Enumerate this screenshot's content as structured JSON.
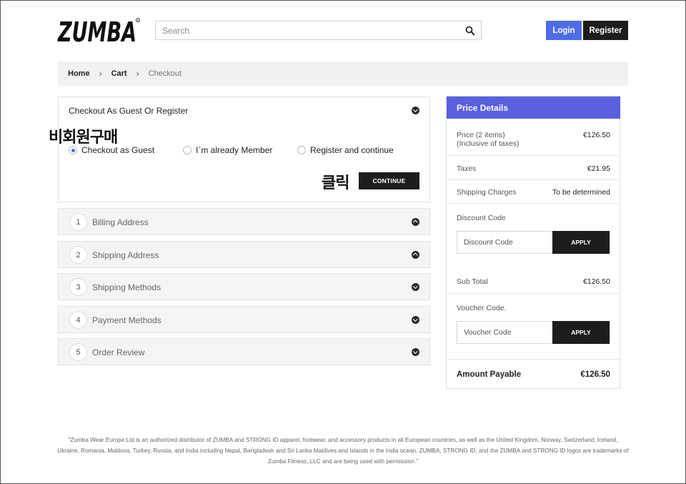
{
  "header": {
    "logo_text": "ZUMBA",
    "search_placeholder": "Search",
    "login_label": "Login",
    "register_label": "Register"
  },
  "breadcrumb": {
    "items": [
      "Home",
      "Cart",
      "Checkout"
    ],
    "separator": "›"
  },
  "annotations": {
    "guest_label": "비회원구매",
    "click_label": "클릭"
  },
  "checkout": {
    "title": "Checkout As Guest Or Register",
    "options": [
      {
        "label": "Checkout as Guest",
        "selected": true
      },
      {
        "label": "I`m already Member",
        "selected": false
      },
      {
        "label": "Register and continue",
        "selected": false
      }
    ],
    "continue_label": "CONTINUE"
  },
  "steps": [
    {
      "num": "1",
      "label": "Billing Address",
      "chevron": "up"
    },
    {
      "num": "2",
      "label": "Shipping Address",
      "chevron": "up"
    },
    {
      "num": "3",
      "label": "Shipping Methods",
      "chevron": "down"
    },
    {
      "num": "4",
      "label": "Payment Methods",
      "chevron": "down"
    },
    {
      "num": "5",
      "label": "Order Review",
      "chevron": "down"
    }
  ],
  "price_details": {
    "title": "Price Details",
    "price_label": "Price (2 items)",
    "price_sublabel": "(Inclusive of taxes)",
    "price_value": "€126.50",
    "taxes_label": "Taxes",
    "taxes_value": "€21.95",
    "shipping_label": "Shipping Charges",
    "shipping_value": "To be determined",
    "discount_label": "Discount Code",
    "discount_placeholder": "Discount Code",
    "apply_label": "APPLY",
    "subtotal_label": "Sub Total",
    "subtotal_value": "€126.50",
    "voucher_label": "Voucher Code.",
    "voucher_placeholder": "Voucher Code",
    "amount_label": "Amount Payable",
    "amount_value": "€126.50"
  },
  "footer": {
    "note": "\"Zumba Wear Europe Ltd is an authorized distributor of ZUMBA and STRONG ID apparel, footwear, and accessory products in all European countries, as well as the United Kingdom, Norway, Switzerland, Iceland, Ukraine, Romania, Moldova, Turkey, Russia, and India including Nepal, Bangladesh and Sri Lanka Maldives and Islands in the India ocean.  ZUMBA, STRONG ID, and the ZUMBA and STRONG ID logos are trademarks of Zumba Fitness, LLC and are being used with permission.\""
  },
  "colors": {
    "accent_blue": "#4f6ce8",
    "price_header": "#5a5fe0",
    "dark_button": "#1d1d1d"
  }
}
